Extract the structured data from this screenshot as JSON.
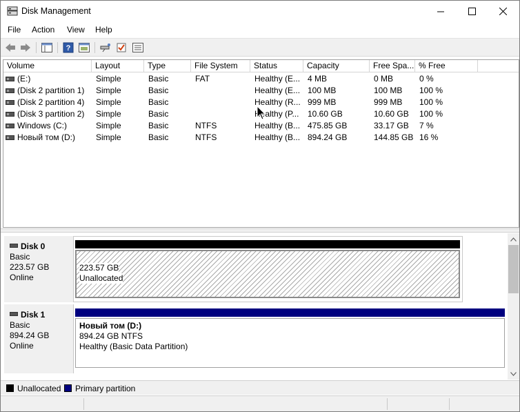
{
  "window": {
    "title": "Disk Management",
    "controls": {
      "minimize": "—",
      "maximize": "☐",
      "close": "✕"
    }
  },
  "menu": [
    {
      "label": "File"
    },
    {
      "label": "Action"
    },
    {
      "label": "View"
    },
    {
      "label": "Help"
    }
  ],
  "toolbar": {
    "icons": [
      "back-arrow-icon",
      "forward-arrow-icon",
      "show-hide-tree-icon",
      "help-icon",
      "properties-icon",
      "connect-drive-icon",
      "check-icon",
      "settings-list-icon"
    ]
  },
  "volumes": {
    "columns": [
      "Volume",
      "Layout",
      "Type",
      "File System",
      "Status",
      "Capacity",
      "Free Spa...",
      "% Free"
    ],
    "rows": [
      {
        "volume": "(E:)",
        "layout": "Simple",
        "type": "Basic",
        "fs": "FAT",
        "status": "Healthy (E...",
        "capacity": "4 MB",
        "free": "0 MB",
        "pct": "0 %"
      },
      {
        "volume": "(Disk 2 partition 1)",
        "layout": "Simple",
        "type": "Basic",
        "fs": "",
        "status": "Healthy (E...",
        "capacity": "100 MB",
        "free": "100 MB",
        "pct": "100 %"
      },
      {
        "volume": "(Disk 2 partition 4)",
        "layout": "Simple",
        "type": "Basic",
        "fs": "",
        "status": "Healthy (R...",
        "capacity": "999 MB",
        "free": "999 MB",
        "pct": "100 %"
      },
      {
        "volume": "(Disk 3 partition 2)",
        "layout": "Simple",
        "type": "Basic",
        "fs": "",
        "status": "Healthy (P...",
        "capacity": "10.60 GB",
        "free": "10.60 GB",
        "pct": "100 %"
      },
      {
        "volume": "Windows (C:)",
        "layout": "Simple",
        "type": "Basic",
        "fs": "NTFS",
        "status": "Healthy (B...",
        "capacity": "475.85 GB",
        "free": "33.17 GB",
        "pct": "7 %"
      },
      {
        "volume": "Новый том (D:)",
        "layout": "Simple",
        "type": "Basic",
        "fs": "NTFS",
        "status": "Healthy (B...",
        "capacity": "894.24 GB",
        "free": "144.85 GB",
        "pct": "16 %"
      }
    ]
  },
  "disks": [
    {
      "name": "Disk 0",
      "type": "Basic",
      "size": "223.57 GB",
      "state": "Online",
      "partition": {
        "size": "223.57 GB",
        "label": "Unallocated",
        "bar_color": "#000000"
      }
    },
    {
      "name": "Disk 1",
      "type": "Basic",
      "size": "894.24 GB",
      "state": "Online",
      "partition": {
        "title": "Новый том  (D:)",
        "size_fs": "894.24 GB NTFS",
        "status": "Healthy (Basic Data Partition)",
        "bar_color": "#00007f"
      }
    }
  ],
  "legend": [
    {
      "label": "Unallocated",
      "color": "#000000"
    },
    {
      "label": "Primary partition",
      "color": "#00007f"
    }
  ]
}
